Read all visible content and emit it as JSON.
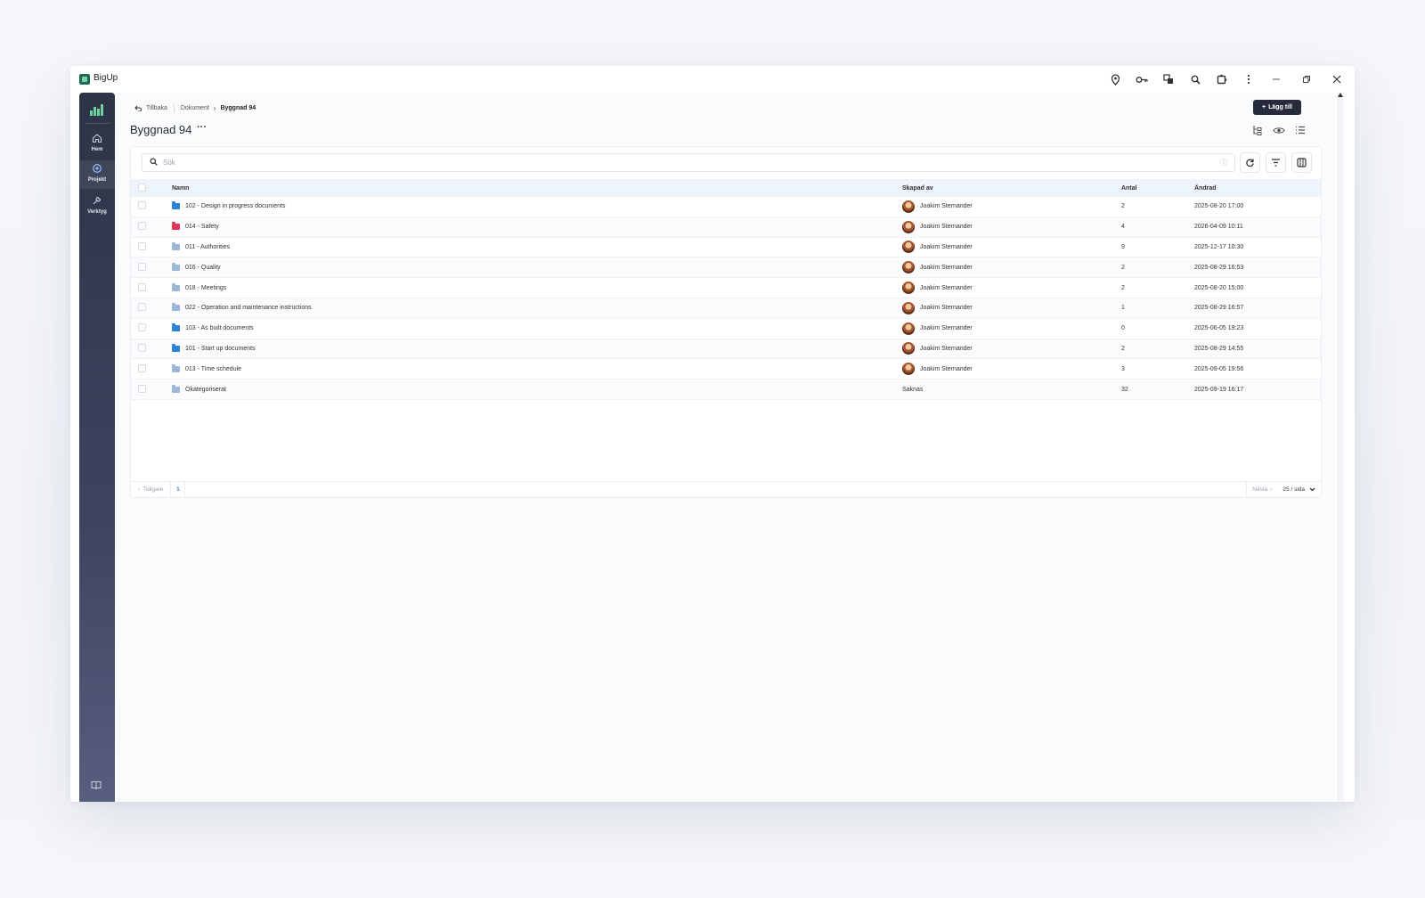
{
  "app": {
    "name": "BigUp"
  },
  "titlebar_icons": [
    "location-pin-icon",
    "key-icon",
    "translate-icon",
    "zoom-icon",
    "extension-icon",
    "kebab-menu-icon"
  ],
  "sidebar": {
    "items": [
      {
        "label": "Hem",
        "icon": "home-icon"
      },
      {
        "label": "Projekt",
        "icon": "project-icon"
      },
      {
        "label": "Verktyg",
        "icon": "wrench-icon"
      }
    ]
  },
  "breadcrumb": {
    "back": "Tillbaka",
    "parent": "Dokument",
    "current": "Byggnad 94"
  },
  "header": {
    "title": "Byggnad 94",
    "add_label": "Lägg till"
  },
  "search": {
    "placeholder": "Sök"
  },
  "table": {
    "columns": {
      "name": "Namn",
      "created_by": "Skapad av",
      "count": "Antal",
      "changed": "Ändrad"
    },
    "rows": [
      {
        "name": "102 - Design in progress documents",
        "by": "Joakim Sternander",
        "count": "2",
        "changed": "2025-08-20 17:00",
        "folder_color": "#2a83d8"
      },
      {
        "name": "014 - Safety",
        "by": "Joakim Sternander",
        "count": "4",
        "changed": "2026-04-09 10:11",
        "folder_color": "#e0355a"
      },
      {
        "name": "011 - Authorities",
        "by": "Joakim Sternander",
        "count": "9",
        "changed": "2025-12-17 10:30",
        "folder_color": "#9cb8d8"
      },
      {
        "name": "016 - Quality",
        "by": "Joakim Sternander",
        "count": "2",
        "changed": "2025-08-29 16:53",
        "folder_color": "#9cb8d8"
      },
      {
        "name": "018 - Meetings",
        "by": "Joakim Sternander",
        "count": "2",
        "changed": "2025-08-20 15:00",
        "folder_color": "#9cb8d8"
      },
      {
        "name": "022 - Operation and maintenance instructions",
        "by": "Joakim Sternander",
        "count": "1",
        "changed": "2025-08-29 16:57",
        "folder_color": "#9cb8d8"
      },
      {
        "name": "103 - As built documents",
        "by": "Joakim Sternander",
        "count": "0",
        "changed": "2025-06-05 19:23",
        "folder_color": "#2a83d8"
      },
      {
        "name": "101 - Start up documents",
        "by": "Joakim Sternander",
        "count": "2",
        "changed": "2025-08-29 14:55",
        "folder_color": "#2a83d8"
      },
      {
        "name": "013 - Time schedule",
        "by": "Joakim Sternander",
        "count": "3",
        "changed": "2025-09-05 19:56",
        "folder_color": "#9cb8d8"
      },
      {
        "name": "Okategoriserat",
        "by": "Saknas",
        "count": "32",
        "changed": "2025-09-19 16:17",
        "folder_color": "#9cb8d8"
      }
    ]
  },
  "pagination": {
    "prev": "Tidigare",
    "page": "1",
    "next": "Nästa",
    "page_size": "25 / sida"
  }
}
